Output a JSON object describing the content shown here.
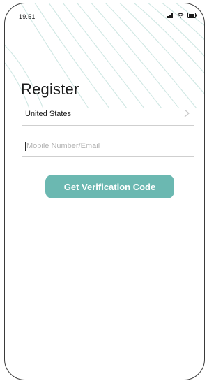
{
  "status_bar": {
    "time": "19.51",
    "icons": [
      "signal-icon",
      "wifi-icon",
      "battery-icon"
    ]
  },
  "page": {
    "title": "Register"
  },
  "country_selector": {
    "value": "United States",
    "icon": "chevron-right-icon"
  },
  "account_input": {
    "placeholder": "Mobile Number/Email",
    "value": ""
  },
  "cta": {
    "label": "Get Verification Code"
  },
  "colors": {
    "accent": "#6bb8b1",
    "wave": "#cfe7e3",
    "divider": "#cfcfcf",
    "placeholder": "#b3b3b3"
  }
}
